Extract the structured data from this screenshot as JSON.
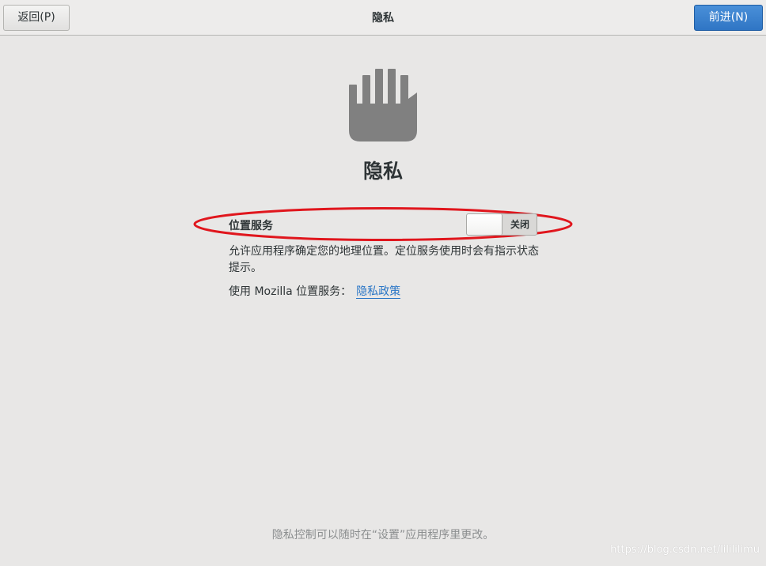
{
  "header": {
    "back_label": "返回(P)",
    "title": "隐私",
    "next_label": "前进(N)"
  },
  "page": {
    "icon": "hand-icon",
    "title": "隐私"
  },
  "location": {
    "label": "位置服务",
    "switch_state": "关闭",
    "switch_on": false,
    "description": "允许应用程序确定您的地理位置。定位服务使用时会有指示状态提示。",
    "mozilla_text": "使用  Mozilla 位置服务：",
    "policy_link": "隐私政策"
  },
  "footer": {
    "note": "隐私控制可以随时在“设置”应用程序里更改。"
  },
  "watermark": "https://blog.csdn.net/lilililimu",
  "colors": {
    "accent": "#2f75c4",
    "link": "#2a76c6",
    "annotation": "#e0161d",
    "icon": "#808080"
  }
}
